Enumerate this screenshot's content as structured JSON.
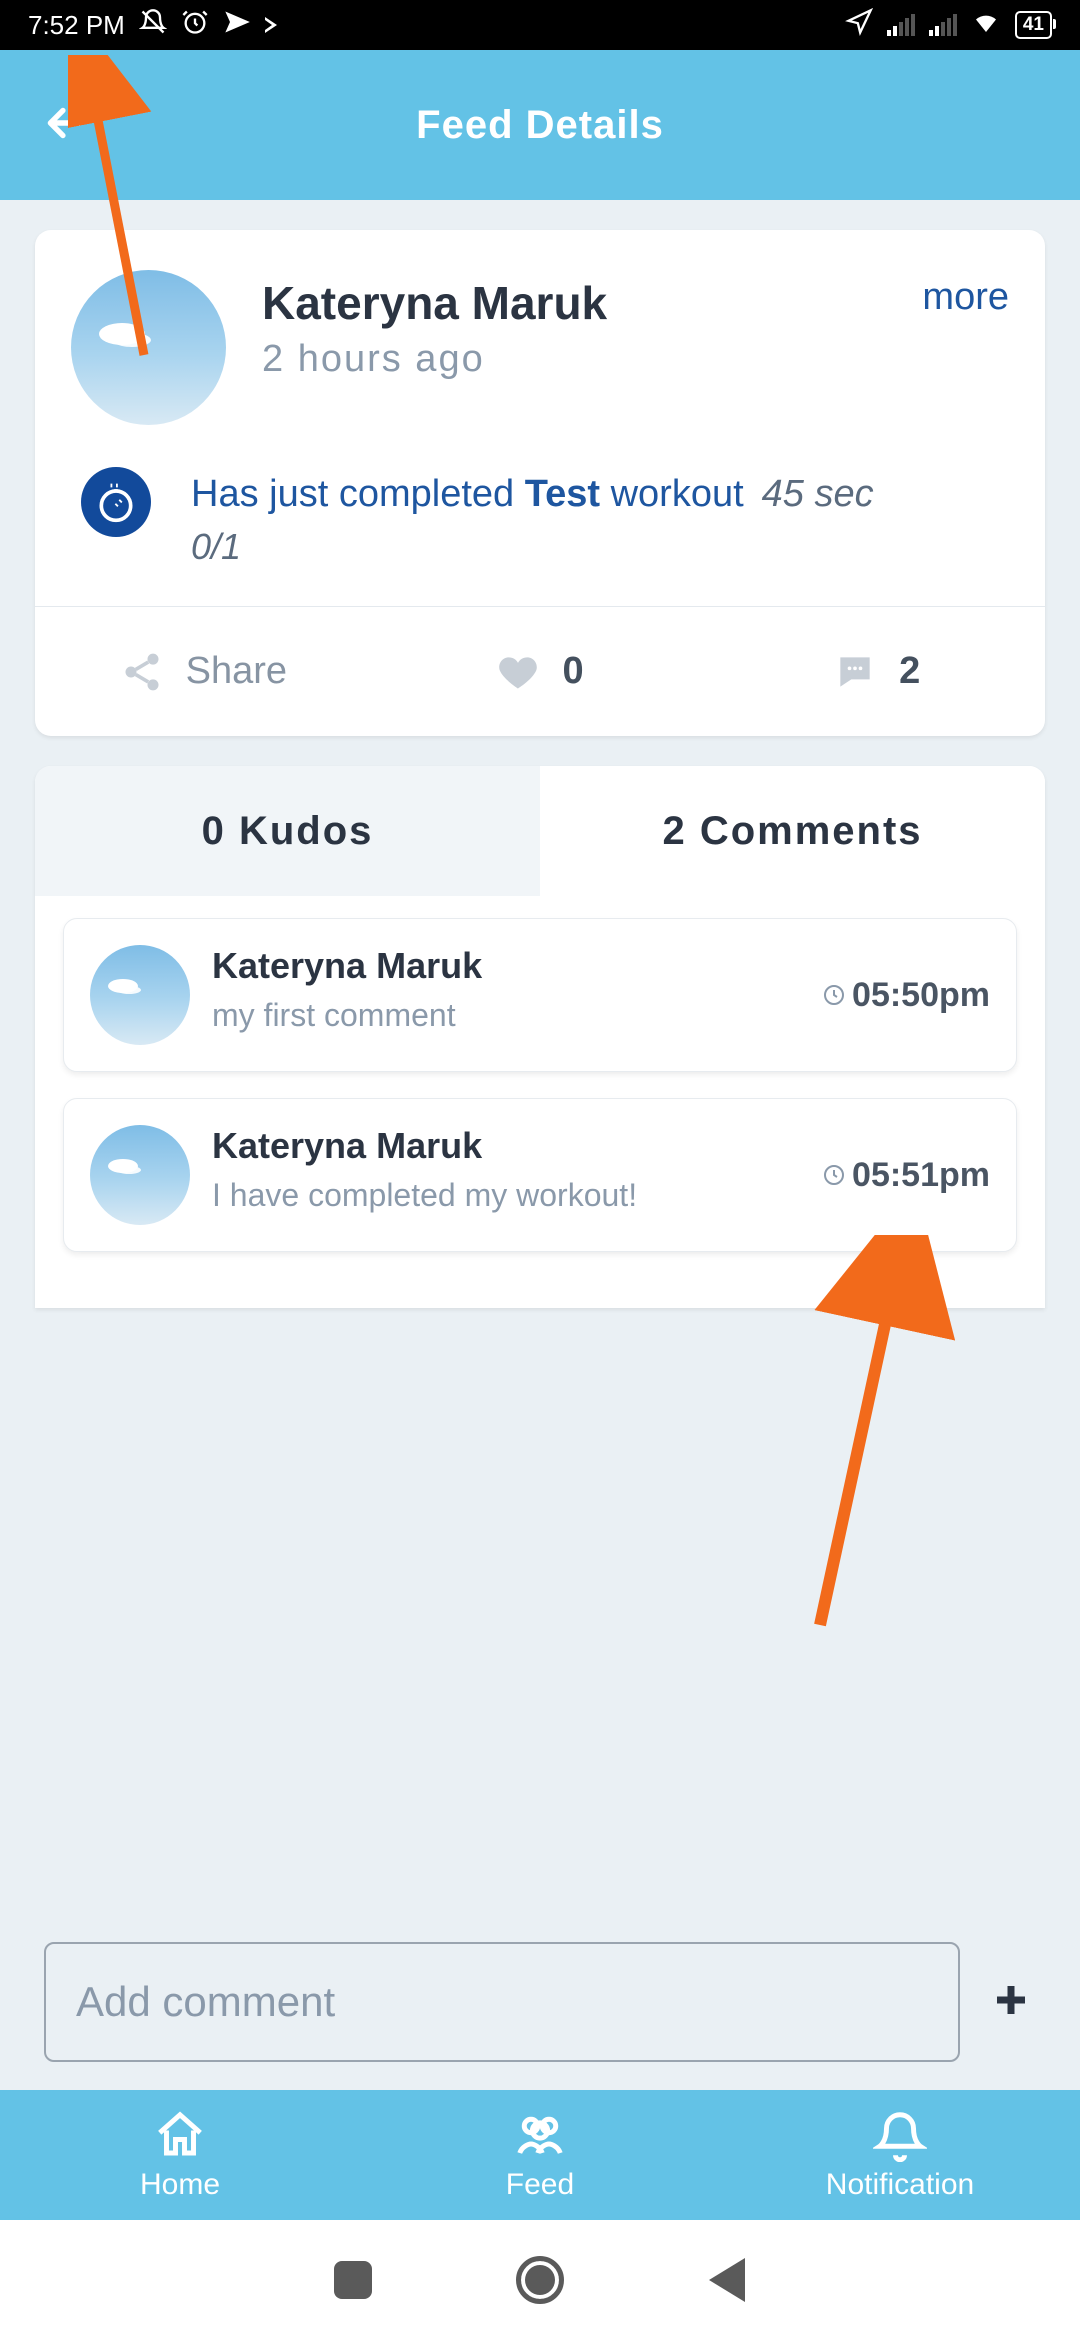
{
  "status": {
    "time": "7:52 PM",
    "battery": "41"
  },
  "header": {
    "title": "Feed Details"
  },
  "post": {
    "author": "Kateryna Maruk",
    "age": "2  hours ago",
    "more": "more",
    "activity_prefix": "Has just completed ",
    "activity_name": "Test",
    "activity_suffix": " workout",
    "duration": "45 sec",
    "progress": "0/1"
  },
  "actions": {
    "share": "Share",
    "like_count": "0",
    "comment_count": "2"
  },
  "tabs": {
    "kudos": "0 Kudos",
    "comments": "2 Comments"
  },
  "comments": [
    {
      "author": "Kateryna Maruk",
      "text": "my first comment",
      "time": "05:50pm"
    },
    {
      "author": "Kateryna Maruk",
      "text": "I have completed my workout!",
      "time": "05:51pm"
    }
  ],
  "input": {
    "placeholder": "Add comment"
  },
  "bottom": {
    "home": "Home",
    "feed": "Feed",
    "notification": "Notification"
  }
}
